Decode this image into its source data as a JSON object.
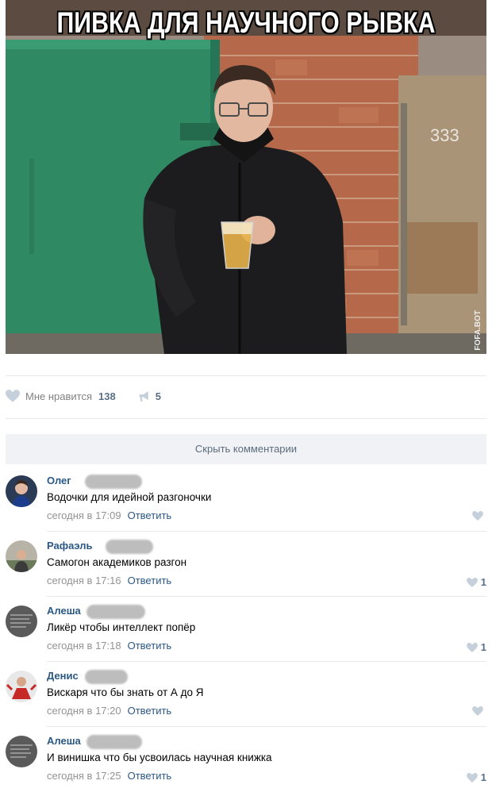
{
  "post": {
    "meme_caption": "ПИВКА ДЛЯ НАУЧНОГО РЫВКА",
    "watermark": "FOFA.BOT",
    "gate_number": "333"
  },
  "actions": {
    "like_label": "Мне нравится",
    "like_count": "138",
    "share_count": "5"
  },
  "hide_comments_label": "Скрыть комментарии",
  "comments": [
    {
      "author": "Олег",
      "text": "Водочки для идейной разгоночки",
      "time": "сегодня в 17:09",
      "reply": "Ответить",
      "likes": ""
    },
    {
      "author": "Рафаэль",
      "text": "Самогон академиков разгон",
      "time": "сегодня в 17:16",
      "reply": "Ответить",
      "likes": "1"
    },
    {
      "author": "Алеша",
      "text": "Ликёр чтобы интеллект попёр",
      "time": "сегодня в 17:18",
      "reply": "Ответить",
      "likes": "1"
    },
    {
      "author": "Денис",
      "text": "Вискаря что бы знать от А до Я",
      "time": "сегодня в 17:20",
      "reply": "Ответить",
      "likes": ""
    },
    {
      "author": "Алеша",
      "text": "И винишка что бы усвоилась научная книжка",
      "time": "сегодня в 17:25",
      "reply": "Ответить",
      "likes": "1"
    }
  ],
  "colors": {
    "link": "#2a5885",
    "muted": "#939393",
    "like_icon": "#c5d0db",
    "button_bg": "#f0f2f5"
  },
  "icons": {
    "like": "heart-icon",
    "share": "megaphone-icon"
  }
}
